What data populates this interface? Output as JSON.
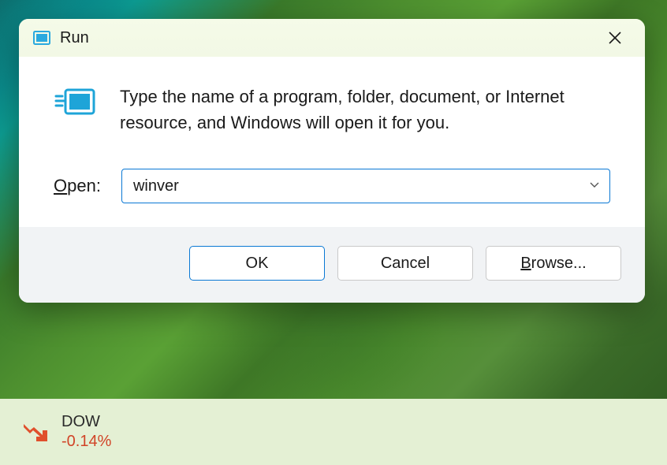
{
  "dialog": {
    "title": "Run",
    "description": "Type the name of a program, folder, document, or Internet resource, and Windows will open it for you.",
    "open_label_underline": "O",
    "open_label_rest": "pen:",
    "input_value": "winver",
    "buttons": {
      "ok": "OK",
      "cancel": "Cancel",
      "browse_underline": "B",
      "browse_rest": "rowse..."
    }
  },
  "taskbar": {
    "stock_name": "DOW",
    "stock_change": "-0.14%",
    "change_color": "#d14427"
  }
}
